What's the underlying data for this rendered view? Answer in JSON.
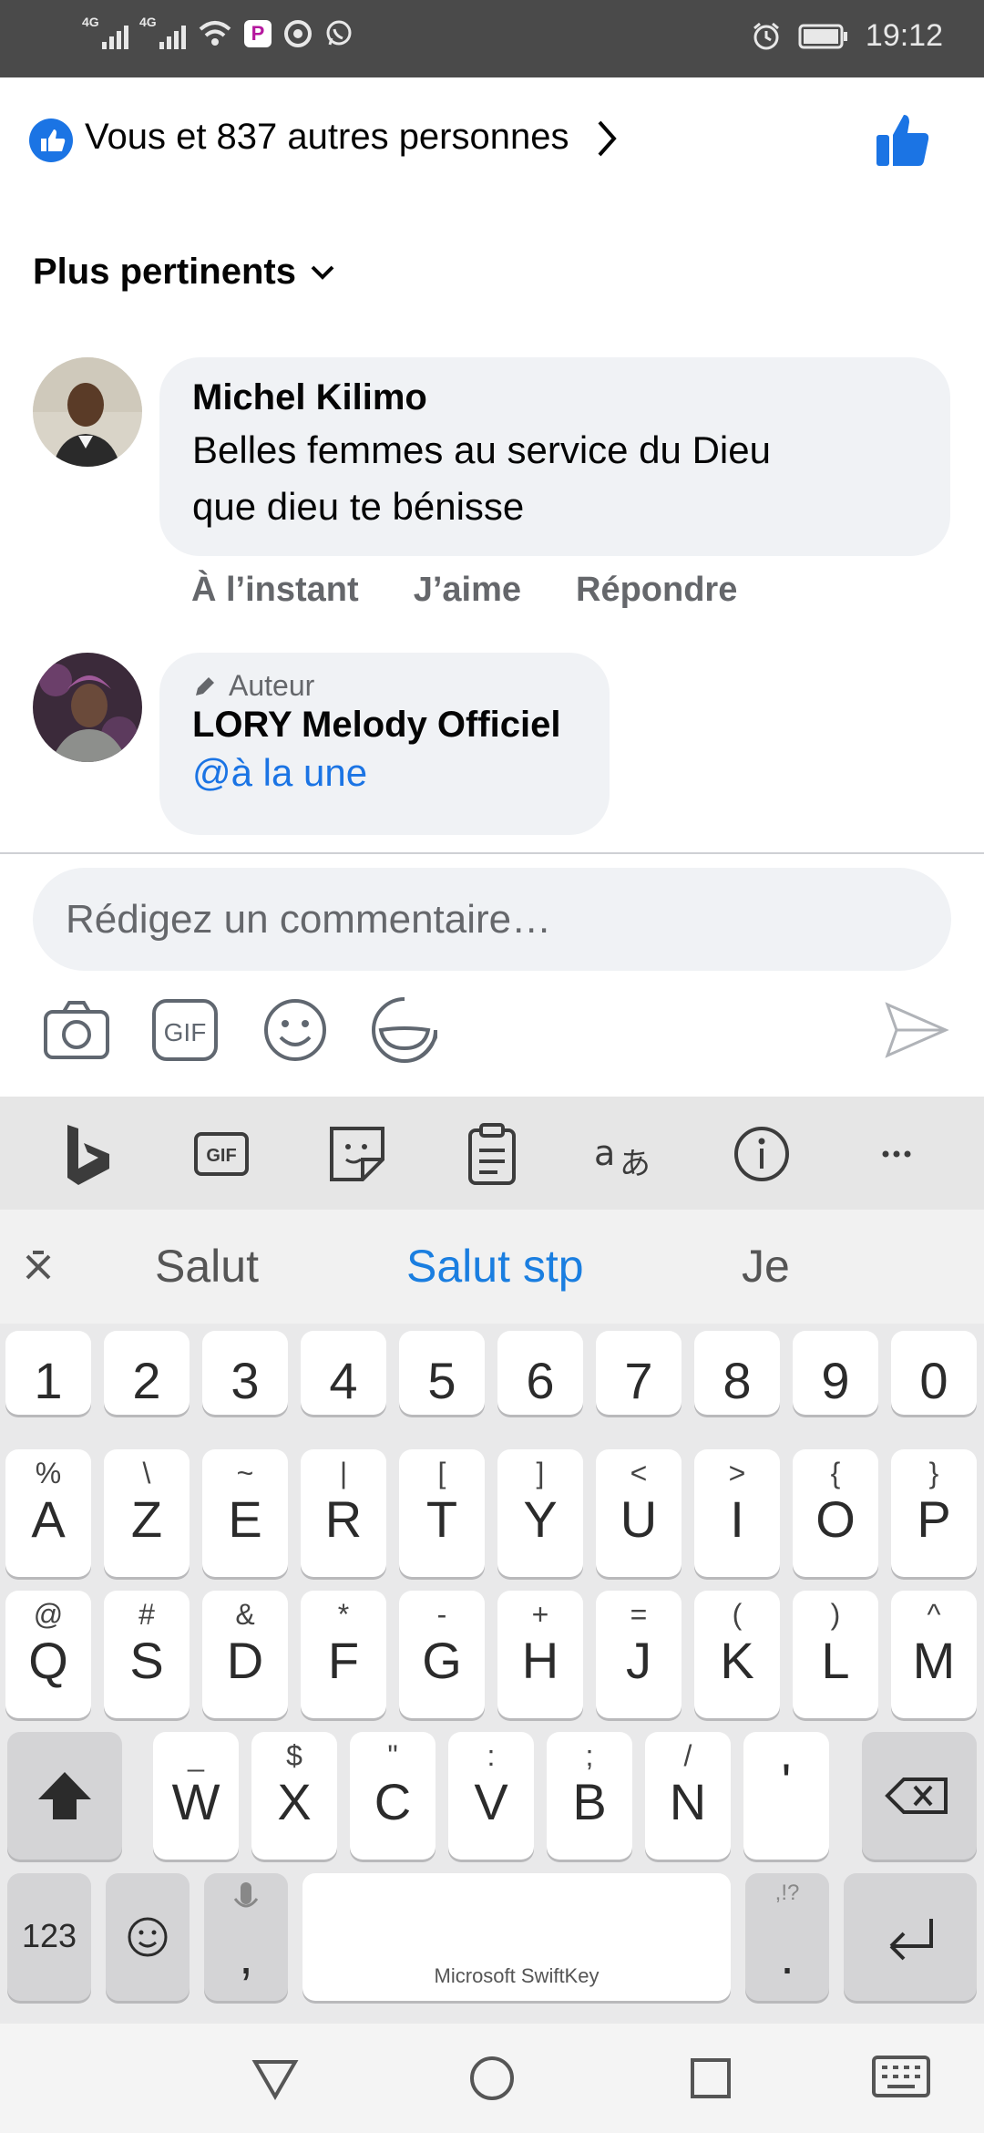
{
  "status_bar": {
    "network_1": "4G",
    "network_2": "4G",
    "app_icon": "P",
    "time": "19:12"
  },
  "reactions": {
    "summary": "Vous et 837 autres personnes"
  },
  "sort": {
    "label": "Plus pertinents"
  },
  "comments": [
    {
      "name": "Michel Kilimo",
      "text_line1": "Belles femmes au service du Dieu",
      "text_line2": "que dieu te bénisse",
      "time": "À l’instant",
      "like_label": "J’aime",
      "reply_label": "Répondre"
    },
    {
      "badge": "Auteur",
      "name": "LORY Melody Officiel",
      "mention": "@à la une"
    }
  ],
  "composer": {
    "placeholder": "Rédigez un commentaire…"
  },
  "keyboard": {
    "suggestions": [
      "Salut",
      "Salut stp",
      "Je"
    ],
    "gif_label": "GIF",
    "number_row": [
      "1",
      "2",
      "3",
      "4",
      "5",
      "6",
      "7",
      "8",
      "9",
      "0"
    ],
    "row1": [
      {
        "main": "A",
        "sec": "%"
      },
      {
        "main": "Z",
        "sec": "\\"
      },
      {
        "main": "E",
        "sec": "~"
      },
      {
        "main": "R",
        "sec": "|"
      },
      {
        "main": "T",
        "sec": "["
      },
      {
        "main": "Y",
        "sec": "]"
      },
      {
        "main": "U",
        "sec": "<"
      },
      {
        "main": "I",
        "sec": ">"
      },
      {
        "main": "O",
        "sec": "{"
      },
      {
        "main": "P",
        "sec": "}"
      }
    ],
    "row2": [
      {
        "main": "Q",
        "sec": "@"
      },
      {
        "main": "S",
        "sec": "#"
      },
      {
        "main": "D",
        "sec": "&"
      },
      {
        "main": "F",
        "sec": "*"
      },
      {
        "main": "G",
        "sec": "-"
      },
      {
        "main": "H",
        "sec": "+"
      },
      {
        "main": "J",
        "sec": "="
      },
      {
        "main": "K",
        "sec": "("
      },
      {
        "main": "L",
        "sec": ")"
      },
      {
        "main": "M",
        "sec": "^"
      }
    ],
    "row3": [
      {
        "main": "W",
        "sec": "_"
      },
      {
        "main": "X",
        "sec": "$"
      },
      {
        "main": "C",
        "sec": "\""
      },
      {
        "main": "V",
        "sec": ":"
      },
      {
        "main": "B",
        "sec": ";"
      },
      {
        "main": "N",
        "sec": "/"
      },
      {
        "main": "'",
        "sec": ""
      }
    ],
    "num_key": "123",
    "comma_key": ",",
    "period_key": ".",
    "period_sec": ",!?",
    "space_label": "Microsoft SwiftKey"
  },
  "colors": {
    "facebook_blue": "#1b74e4",
    "bubble": "#f0f2f5",
    "secondary_text": "#65676b"
  }
}
